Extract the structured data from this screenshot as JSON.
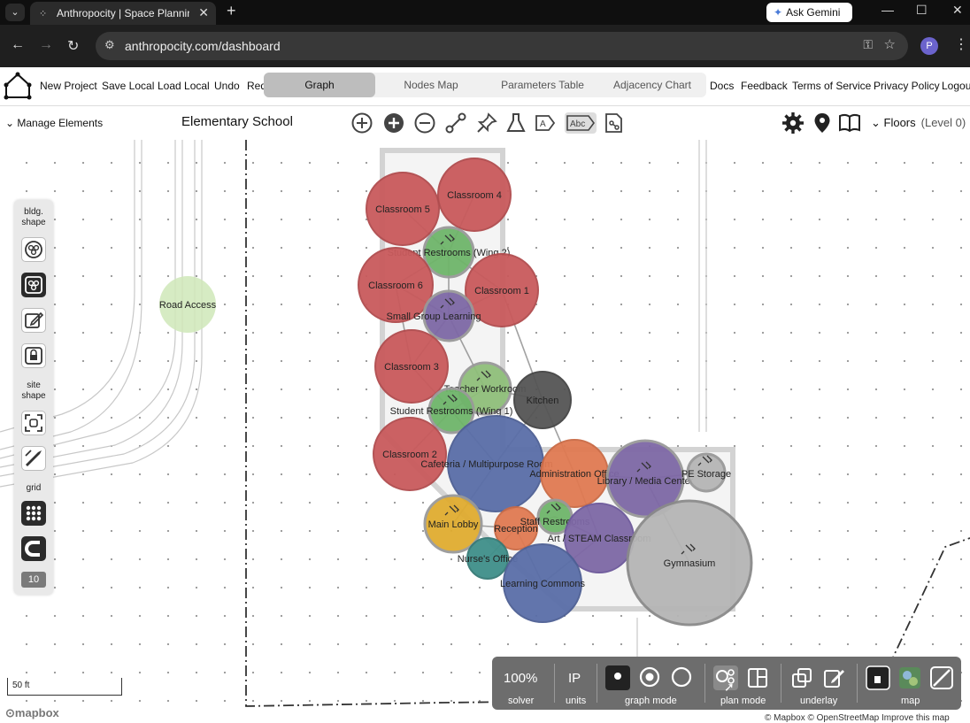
{
  "browser": {
    "tab_title": "Anthropocity | Space Planning",
    "new_tab": "+",
    "gemini_label": "Ask Gemini",
    "url": "anthropocity.com/dashboard",
    "profile_initial": "P"
  },
  "app": {
    "menu": [
      "New Project",
      "Save Local",
      "Load Local",
      "Undo",
      "Red"
    ],
    "tabs": [
      "Graph",
      "Nodes Map",
      "Parameters Table",
      "Adjacency Chart"
    ],
    "active_tab": "Graph",
    "right_menu": [
      "Docs",
      "Feedback",
      "Terms of Service",
      "Privacy Policy",
      "Logout"
    ]
  },
  "toolbar": {
    "manage_label": "Manage Elements",
    "project_title": "Elementary School",
    "floors_label": "Floors",
    "level_label": "(Level 0)",
    "tools": [
      "add-node-icon",
      "add-filled-icon",
      "remove-icon",
      "link-icon",
      "pin-icon",
      "flask-icon",
      "label-icon",
      "abc-label-icon",
      "export-icon"
    ]
  },
  "palette": {
    "bldg_shape": "bldg. shape",
    "site_shape": "site shape",
    "grid": "grid",
    "grid_size": "10"
  },
  "nodes": [
    {
      "name": "Classroom 5",
      "color": "#c95a5c"
    },
    {
      "name": "Classroom 4",
      "color": "#c95a5c"
    },
    {
      "name": "Student Restrooms (Wing 2)",
      "color": "#6fb56a"
    },
    {
      "name": "Classroom 6",
      "color": "#c95a5c"
    },
    {
      "name": "Classroom 1",
      "color": "#c95a5c"
    },
    {
      "name": "Small Group Learning",
      "color": "#7e68a6"
    },
    {
      "name": "Classroom 3",
      "color": "#c95a5c"
    },
    {
      "name": "Teacher Workroom",
      "color": "#8fbf7a"
    },
    {
      "name": "Kitchen",
      "color": "#555555"
    },
    {
      "name": "Student Restrooms (Wing 1)",
      "color": "#6fb56a"
    },
    {
      "name": "Classroom 2",
      "color": "#c95a5c"
    },
    {
      "name": "Cafeteria / Multipurpose Room",
      "color": "#5a6ea8"
    },
    {
      "name": "Administration Office",
      "color": "#e07a52"
    },
    {
      "name": "Library / Media Center",
      "color": "#7e68a6"
    },
    {
      "name": "PE Storage",
      "color": "#b5b5b5"
    },
    {
      "name": "Main Lobby",
      "color": "#e0ac30"
    },
    {
      "name": "Reception",
      "color": "#e07a52"
    },
    {
      "name": "Staff Restrooms",
      "color": "#6fb56a"
    },
    {
      "name": "Art / STEAM Classroom",
      "color": "#7e68a6"
    },
    {
      "name": "Nurse's Office",
      "color": "#3f8f8a"
    },
    {
      "name": "Learning Commons",
      "color": "#5a6ea8"
    },
    {
      "name": "Gymnasium",
      "color": "#b5b5b5"
    },
    {
      "name": "Road Access",
      "color": "#cfe8b8"
    }
  ],
  "bottombar": {
    "zoom": "100%",
    "units": "IP",
    "labels": [
      "solver",
      "units",
      "graph mode",
      "plan mode",
      "underlay",
      "map"
    ]
  },
  "map": {
    "scale_label": "50 ft",
    "mapbox": "mapbox",
    "attribution": "© Mapbox © OpenStreetMap Improve this map"
  }
}
